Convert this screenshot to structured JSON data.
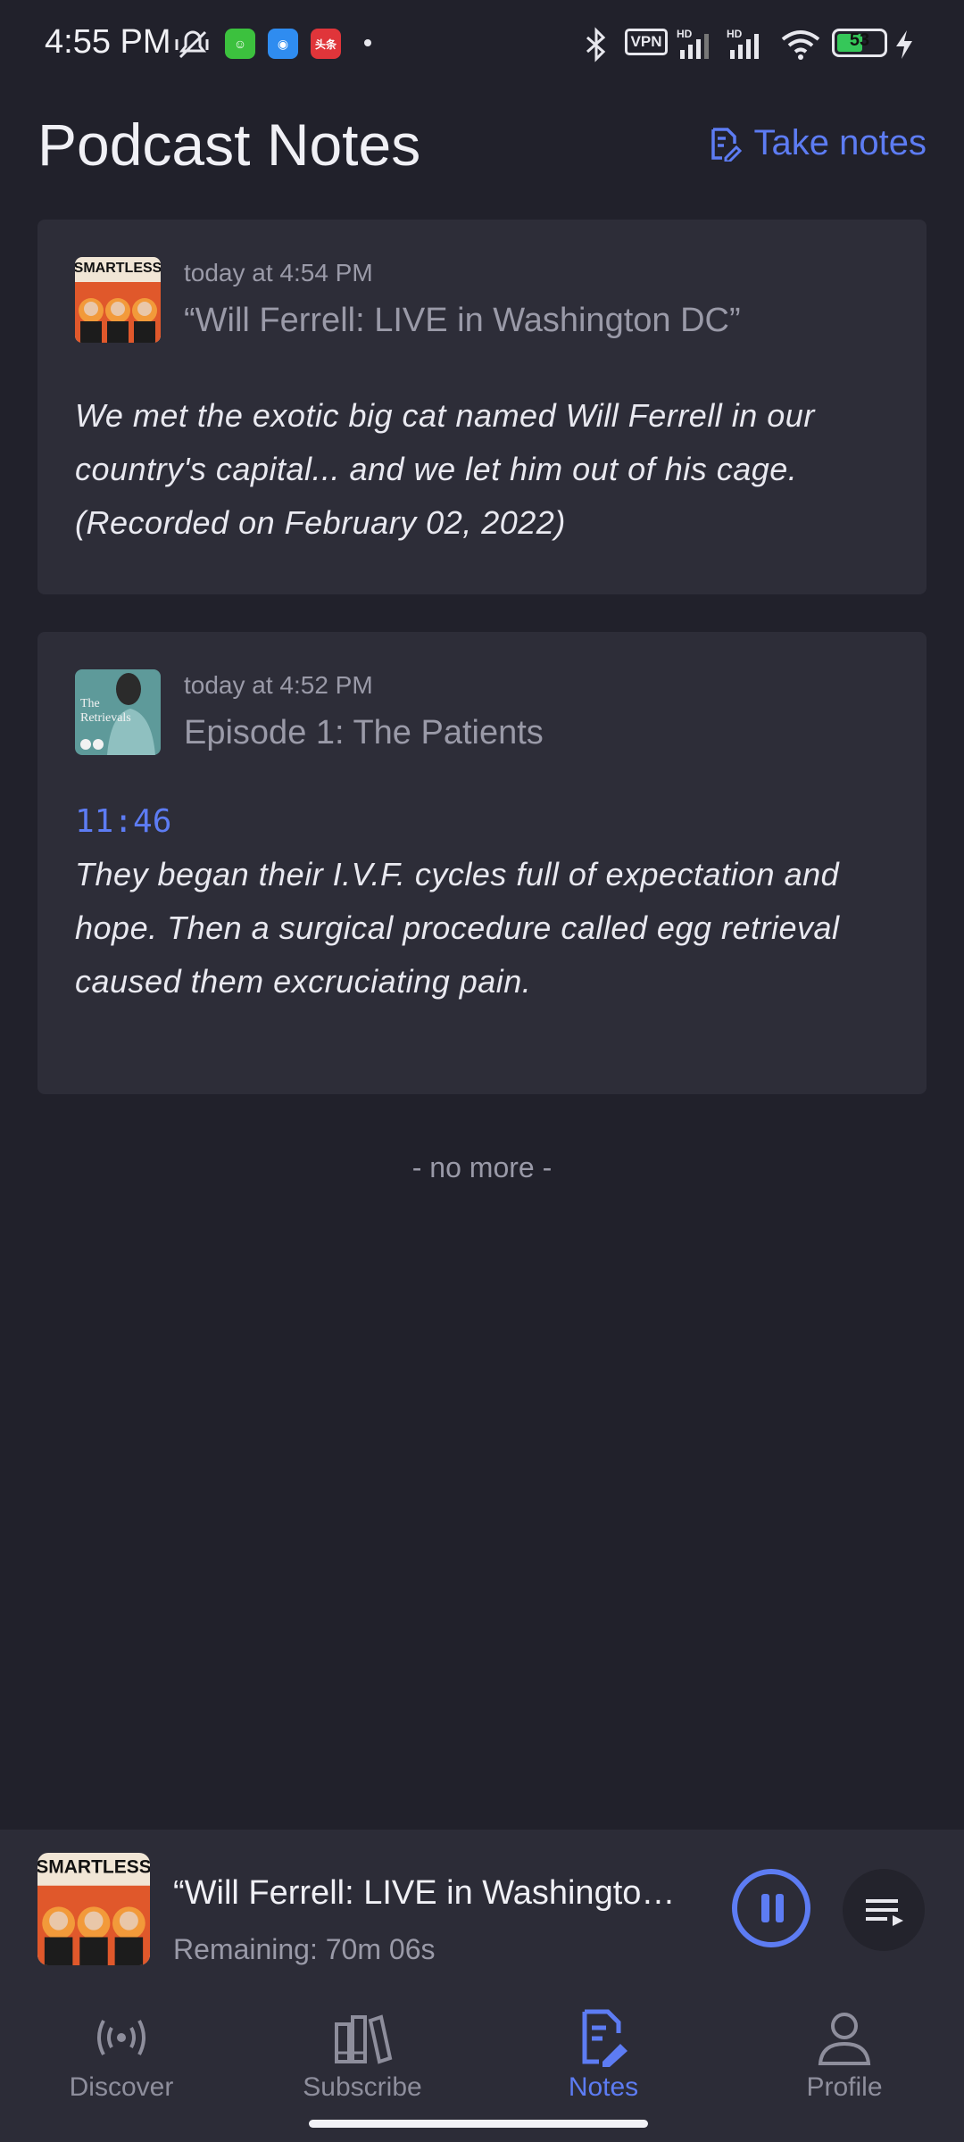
{
  "status_bar": {
    "time": "4:55 PM",
    "vpn": "VPN",
    "battery": "53",
    "icons": [
      "mute-icon",
      "app-icon-green",
      "app-icon-blue",
      "app-icon-red",
      "bluetooth-icon",
      "signal-icon",
      "signal-icon",
      "wifi-icon",
      "charging-icon"
    ]
  },
  "header": {
    "title": "Podcast Notes",
    "take_notes_label": "Take notes"
  },
  "notes": [
    {
      "time": "today at 4:54 PM",
      "title": "“Will Ferrell: LIVE in Washington DC”",
      "body": "We met the exotic big cat named Will Ferrell in our country's capital... and we let him out of his cage. (Recorded on February 02, 2022)",
      "art": "SMARTLESS"
    },
    {
      "time": "today at 4:52 PM",
      "title": "Episode 1: The Patients",
      "timestamp": "11:46",
      "body": "They began their I.V.F. cycles full of expectation and hope. Then a surgical procedure called egg retrieval caused them excruciating pain.",
      "art": "The Retrievals"
    }
  ],
  "list_footer": "- no more -",
  "player": {
    "title": "“Will Ferrell: LIVE in Washington DC”",
    "remaining": "Remaining: 70m 06s",
    "art": "SMARTLESS"
  },
  "nav": {
    "items": [
      {
        "label": "Discover",
        "icon": "broadcast-icon"
      },
      {
        "label": "Subscribe",
        "icon": "library-icon"
      },
      {
        "label": "Notes",
        "icon": "notes-icon",
        "active": true
      },
      {
        "label": "Profile",
        "icon": "profile-icon"
      }
    ]
  },
  "colors": {
    "accent": "#5d7cf3",
    "background": "#21212b",
    "card": "#2d2d38"
  }
}
